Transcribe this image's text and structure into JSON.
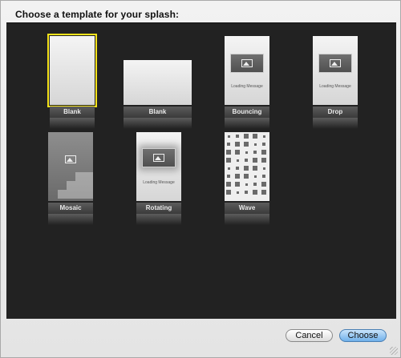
{
  "dialog": {
    "title": "Choose a template for your splash:"
  },
  "templates": [
    {
      "name": "Blank",
      "kind": "blank-portrait",
      "selected": true
    },
    {
      "name": "Blank",
      "kind": "blank-landscape",
      "selected": false
    },
    {
      "name": "Bouncing",
      "kind": "bouncing",
      "selected": false
    },
    {
      "name": "Drop",
      "kind": "drop",
      "selected": false
    },
    {
      "name": "Mosaic",
      "kind": "mosaic",
      "selected": false
    },
    {
      "name": "Rotating",
      "kind": "rotating",
      "selected": false
    },
    {
      "name": "Wave",
      "kind": "wave",
      "selected": false
    }
  ],
  "thumb_text": {
    "loading_message": "Loading Message"
  },
  "buttons": {
    "cancel": "Cancel",
    "choose": "Choose"
  },
  "colors": {
    "gallery_bg": "#222222",
    "selection": "#f4e21a",
    "primary_button": "#6fb0ea"
  }
}
